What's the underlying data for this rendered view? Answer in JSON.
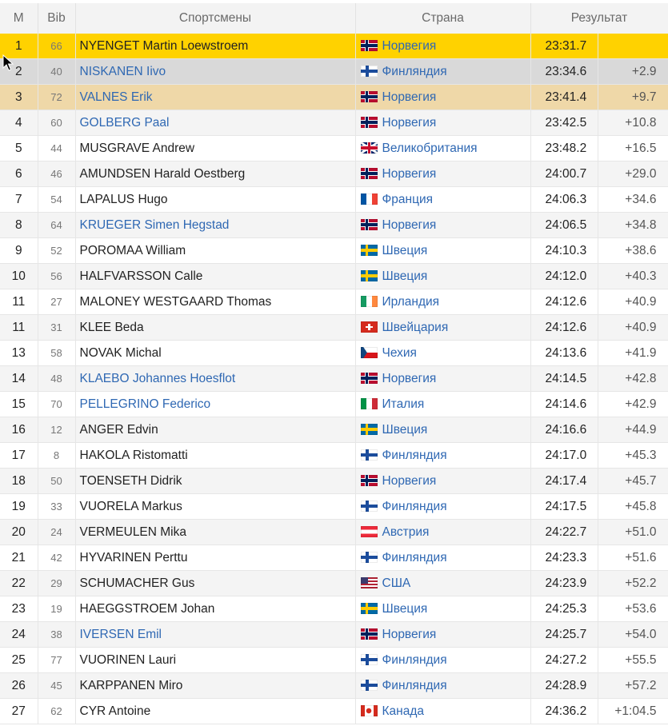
{
  "header": {
    "rank": "М",
    "bib": "Bib",
    "athletes": "Спортсмены",
    "country": "Страна",
    "result": "Результат"
  },
  "colors": {
    "gold": "#ffd200",
    "silver": "#d9d9d9",
    "bronze": "#efd8a8",
    "link": "#2f68b3"
  },
  "rows": [
    {
      "rank": "1",
      "bib": "66",
      "name": "NYENGET Martin Loewstroem",
      "linked": false,
      "flag": "norway",
      "country": "Норвегия",
      "time": "23:31.7",
      "diff": ""
    },
    {
      "rank": "2",
      "bib": "40",
      "name": "NISKANEN Iivo",
      "linked": true,
      "flag": "finland",
      "country": "Финляндия",
      "time": "23:34.6",
      "diff": "+2.9"
    },
    {
      "rank": "3",
      "bib": "72",
      "name": "VALNES Erik",
      "linked": true,
      "flag": "norway",
      "country": "Норвегия",
      "time": "23:41.4",
      "diff": "+9.7"
    },
    {
      "rank": "4",
      "bib": "60",
      "name": "GOLBERG Paal",
      "linked": true,
      "flag": "norway",
      "country": "Норвегия",
      "time": "23:42.5",
      "diff": "+10.8"
    },
    {
      "rank": "5",
      "bib": "44",
      "name": "MUSGRAVE Andrew",
      "linked": false,
      "flag": "uk",
      "country": "Великобритания",
      "time": "23:48.2",
      "diff": "+16.5"
    },
    {
      "rank": "6",
      "bib": "46",
      "name": "AMUNDSEN Harald Oestberg",
      "linked": false,
      "flag": "norway",
      "country": "Норвегия",
      "time": "24:00.7",
      "diff": "+29.0"
    },
    {
      "rank": "7",
      "bib": "54",
      "name": "LAPALUS Hugo",
      "linked": false,
      "flag": "france",
      "country": "Франция",
      "time": "24:06.3",
      "diff": "+34.6"
    },
    {
      "rank": "8",
      "bib": "64",
      "name": "KRUEGER Simen Hegstad",
      "linked": true,
      "flag": "norway",
      "country": "Норвегия",
      "time": "24:06.5",
      "diff": "+34.8"
    },
    {
      "rank": "9",
      "bib": "52",
      "name": "POROMAA William",
      "linked": false,
      "flag": "sweden",
      "country": "Швеция",
      "time": "24:10.3",
      "diff": "+38.6"
    },
    {
      "rank": "10",
      "bib": "56",
      "name": "HALFVARSSON Calle",
      "linked": false,
      "flag": "sweden",
      "country": "Швеция",
      "time": "24:12.0",
      "diff": "+40.3"
    },
    {
      "rank": "11",
      "bib": "27",
      "name": "MALONEY WESTGAARD Thomas",
      "linked": false,
      "flag": "ireland",
      "country": "Ирландия",
      "time": "24:12.6",
      "diff": "+40.9"
    },
    {
      "rank": "11",
      "bib": "31",
      "name": "KLEE Beda",
      "linked": false,
      "flag": "switzerland",
      "country": "Швейцария",
      "time": "24:12.6",
      "diff": "+40.9"
    },
    {
      "rank": "13",
      "bib": "58",
      "name": "NOVAK Michal",
      "linked": false,
      "flag": "czech",
      "country": "Чехия",
      "time": "24:13.6",
      "diff": "+41.9"
    },
    {
      "rank": "14",
      "bib": "48",
      "name": "KLAEBO Johannes Hoesflot",
      "linked": true,
      "flag": "norway",
      "country": "Норвегия",
      "time": "24:14.5",
      "diff": "+42.8"
    },
    {
      "rank": "15",
      "bib": "70",
      "name": "PELLEGRINO Federico",
      "linked": true,
      "flag": "italy",
      "country": "Италия",
      "time": "24:14.6",
      "diff": "+42.9"
    },
    {
      "rank": "16",
      "bib": "12",
      "name": "ANGER Edvin",
      "linked": false,
      "flag": "sweden",
      "country": "Швеция",
      "time": "24:16.6",
      "diff": "+44.9"
    },
    {
      "rank": "17",
      "bib": "8",
      "name": "HAKOLA Ristomatti",
      "linked": false,
      "flag": "finland",
      "country": "Финляндия",
      "time": "24:17.0",
      "diff": "+45.3"
    },
    {
      "rank": "18",
      "bib": "50",
      "name": "TOENSETH Didrik",
      "linked": false,
      "flag": "norway",
      "country": "Норвегия",
      "time": "24:17.4",
      "diff": "+45.7"
    },
    {
      "rank": "19",
      "bib": "33",
      "name": "VUORELA Markus",
      "linked": false,
      "flag": "finland",
      "country": "Финляндия",
      "time": "24:17.5",
      "diff": "+45.8"
    },
    {
      "rank": "20",
      "bib": "24",
      "name": "VERMEULEN Mika",
      "linked": false,
      "flag": "austria",
      "country": "Австрия",
      "time": "24:22.7",
      "diff": "+51.0"
    },
    {
      "rank": "21",
      "bib": "42",
      "name": "HYVARINEN Perttu",
      "linked": false,
      "flag": "finland",
      "country": "Финляндия",
      "time": "24:23.3",
      "diff": "+51.6"
    },
    {
      "rank": "22",
      "bib": "29",
      "name": "SCHUMACHER Gus",
      "linked": false,
      "flag": "usa",
      "country": "США",
      "time": "24:23.9",
      "diff": "+52.2"
    },
    {
      "rank": "23",
      "bib": "19",
      "name": "HAEGGSTROEM Johan",
      "linked": false,
      "flag": "sweden",
      "country": "Швеция",
      "time": "24:25.3",
      "diff": "+53.6"
    },
    {
      "rank": "24",
      "bib": "38",
      "name": "IVERSEN Emil",
      "linked": true,
      "flag": "norway",
      "country": "Норвегия",
      "time": "24:25.7",
      "diff": "+54.0"
    },
    {
      "rank": "25",
      "bib": "77",
      "name": "VUORINEN Lauri",
      "linked": false,
      "flag": "finland",
      "country": "Финляндия",
      "time": "24:27.2",
      "diff": "+55.5"
    },
    {
      "rank": "26",
      "bib": "45",
      "name": "KARPPANEN Miro",
      "linked": false,
      "flag": "finland",
      "country": "Финляндия",
      "time": "24:28.9",
      "diff": "+57.2"
    },
    {
      "rank": "27",
      "bib": "62",
      "name": "CYR Antoine",
      "linked": false,
      "flag": "canada",
      "country": "Канада",
      "time": "24:36.2",
      "diff": "+1:04.5"
    }
  ]
}
